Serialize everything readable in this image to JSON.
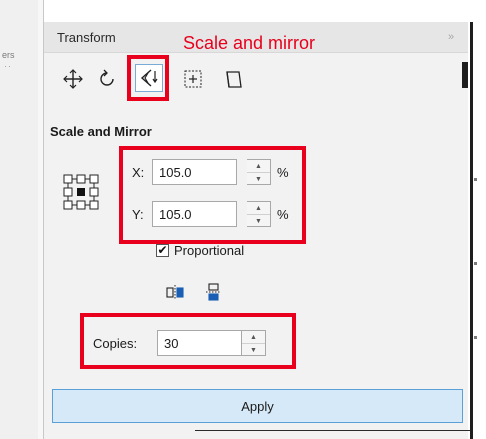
{
  "neighbor_tab": {
    "label": "ers",
    "dots": "··"
  },
  "panel": {
    "title": "Transform",
    "collapse_icon": "double-chevron-right-icon",
    "annotation": "Scale and mirror"
  },
  "toolbar": {
    "tools": [
      {
        "name": "position-tool",
        "icon": "move-arrows-icon"
      },
      {
        "name": "rotate-tool",
        "icon": "rotate-icon"
      },
      {
        "name": "scale-mirror-tool",
        "icon": "scale-mirror-icon",
        "active": true
      },
      {
        "name": "size-tool",
        "icon": "size-icon"
      },
      {
        "name": "skew-tool",
        "icon": "skew-icon"
      }
    ]
  },
  "section": {
    "title": "Scale and Mirror"
  },
  "fields": {
    "x": {
      "label": "X:",
      "value": "105.0",
      "unit": "%"
    },
    "y": {
      "label": "Y:",
      "value": "105.0",
      "unit": "%"
    },
    "copies": {
      "label": "Copies:",
      "value": "30"
    }
  },
  "proportional": {
    "label": "Proportional",
    "checked": true,
    "check_glyph": "✔"
  },
  "mirror_buttons": [
    {
      "name": "mirror-horizontal",
      "icon": "mirror-horizontal-icon"
    },
    {
      "name": "mirror-vertical",
      "icon": "mirror-vertical-icon"
    }
  ],
  "apply_button": {
    "label": "Apply"
  },
  "colors": {
    "annotation": "#e8001c",
    "apply_bg": "#d6e9f8",
    "apply_border": "#5aa0d6"
  }
}
